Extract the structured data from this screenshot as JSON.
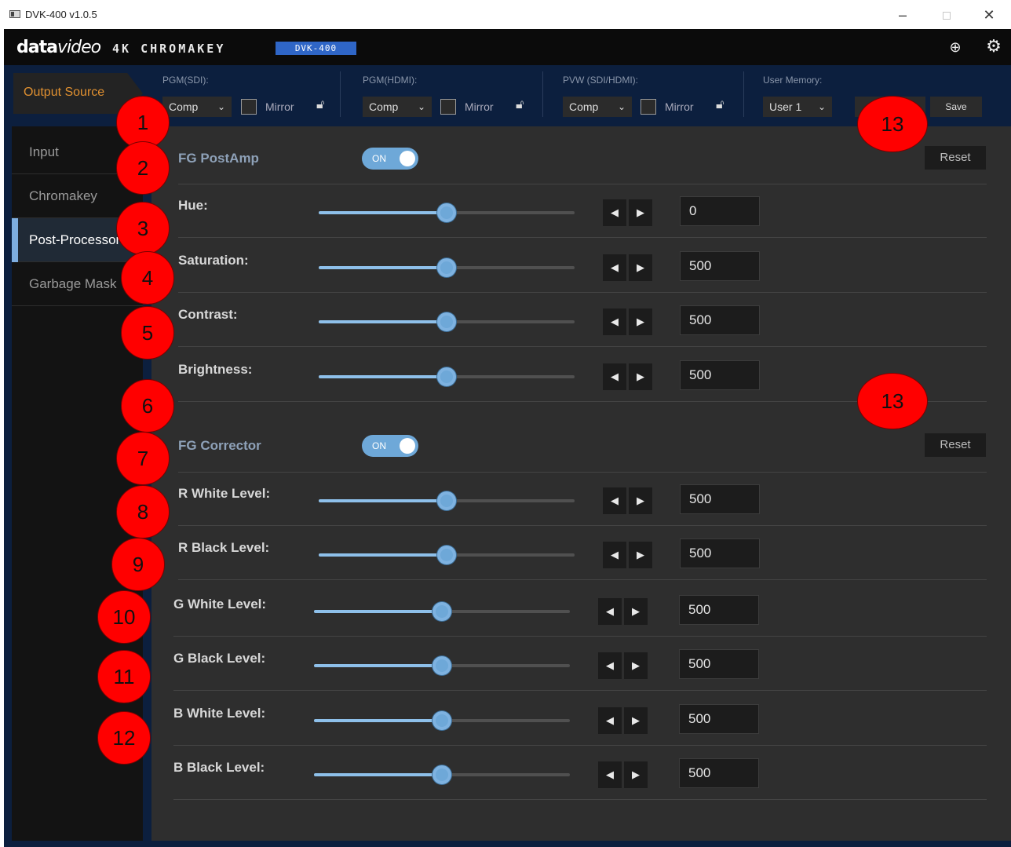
{
  "window": {
    "title": "DVK-400 v1.0.5",
    "minimize": "–",
    "close": "✕"
  },
  "brand": {
    "logo_a": "data",
    "logo_b": "video",
    "product": "4K CHROMAKEY",
    "model": "DVK-400",
    "globe_icon": "globe-icon",
    "settings_icon": "gear-icon"
  },
  "output": {
    "tab_label": "Output Source",
    "pgm_sdi": {
      "label": "PGM(SDI):",
      "value": "Comp",
      "mirror": "Mirror"
    },
    "pgm_hdmi": {
      "label": "PGM(HDMI):",
      "value": "Comp",
      "mirror": "Mirror"
    },
    "pvw": {
      "label": "PVW (SDI/HDMI):",
      "value": "Comp",
      "mirror": "Mirror"
    },
    "memory": {
      "label": "User Memory:",
      "value": "User 1",
      "save": "Save"
    }
  },
  "sidebar": {
    "items": [
      {
        "label": "Input"
      },
      {
        "label": "Chromakey"
      },
      {
        "label": "Post-Processor"
      },
      {
        "label": "Garbage Mask"
      }
    ],
    "active": "Post-Processor"
  },
  "postamp": {
    "title": "FG PostAmp",
    "toggle": "ON",
    "reset": "Reset",
    "params": [
      {
        "label": "Hue:",
        "value": "0",
        "level": 0.5
      },
      {
        "label": "Saturation:",
        "value": "500",
        "level": 0.5
      },
      {
        "label": "Contrast:",
        "value": "500",
        "level": 0.5
      },
      {
        "label": "Brightness:",
        "value": "500",
        "level": 0.5
      }
    ]
  },
  "corrector": {
    "title": "FG Corrector",
    "toggle": "ON",
    "reset": "Reset",
    "params": [
      {
        "label": "R White Level:",
        "value": "500",
        "level": 0.5
      },
      {
        "label": "R Black Level:",
        "value": "500",
        "level": 0.5
      },
      {
        "label": "G White Level:",
        "value": "500",
        "level": 0.5
      },
      {
        "label": "G Black Level:",
        "value": "500",
        "level": 0.5
      },
      {
        "label": "B White Level:",
        "value": "500",
        "level": 0.5
      },
      {
        "label": "B Black Level:",
        "value": "500",
        "level": 0.5
      }
    ]
  },
  "controls": {
    "left_arrow": "◀",
    "right_arrow": "▶",
    "chevron": "⌄"
  },
  "callouts": [
    "1",
    "2",
    "3",
    "4",
    "5",
    "6",
    "7",
    "8",
    "9",
    "10",
    "11",
    "12",
    "13",
    "13"
  ],
  "colors": {
    "accent": "#6ea8d8",
    "output_tab": "#e09030",
    "callout": "#ff0000",
    "brand_badge": "#2f66c7"
  }
}
